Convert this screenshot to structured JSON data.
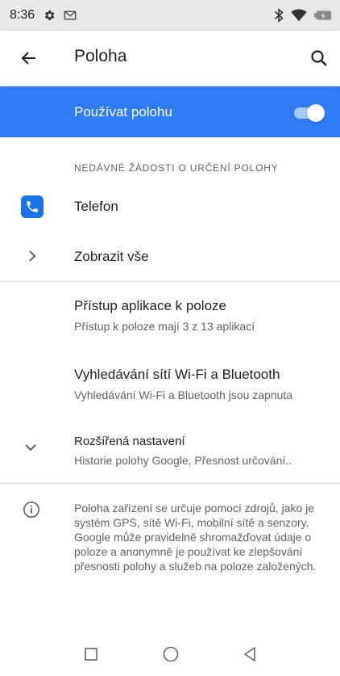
{
  "status_bar": {
    "time": "8:36",
    "icons": [
      "settings-icon",
      "gmail-icon",
      "bluetooth-icon",
      "wifi-icon",
      "battery-icon"
    ]
  },
  "app_bar": {
    "title": "Poloha",
    "back_icon": "arrow-back-icon",
    "search_icon": "search-icon"
  },
  "master_switch": {
    "label": "Používat polohu",
    "enabled": true,
    "accent_color": "#2f7bf5"
  },
  "recent_requests": {
    "header": "NEDÁVNÉ ŽÁDOSTI O URČENÍ POLOHY",
    "apps": [
      {
        "label": "Telefon",
        "icon": "phone-icon"
      }
    ],
    "see_all": "Zobrazit vše"
  },
  "settings": [
    {
      "title": "Přístup aplikace k poloze",
      "summary": "Přístup k poloze mají 3 z 13 aplikací"
    },
    {
      "title": "Vyhledávání sítí Wi-Fi a Bluetooth",
      "summary": "Vyhledávání Wi-Fi a Bluetooth jsou zapnuta"
    },
    {
      "title": "Rozšířená nastavení",
      "summary": "Historie polohy Google, Přesnost určování.."
    }
  ],
  "footer_info": {
    "icon": "info-icon",
    "text": "Poloha zařízení se určuje pomocí zdrojů, jako je systém GPS, sítě Wi-Fi, mobilní sítě a senzory. Google může pravidelně shromažďovat údaje o poloze a anonymně je používat ke zlepšování přesnosti polohy a služeb na poloze založených."
  },
  "nav_bar": {
    "buttons": [
      "recents-button",
      "home-button",
      "back-button"
    ]
  }
}
